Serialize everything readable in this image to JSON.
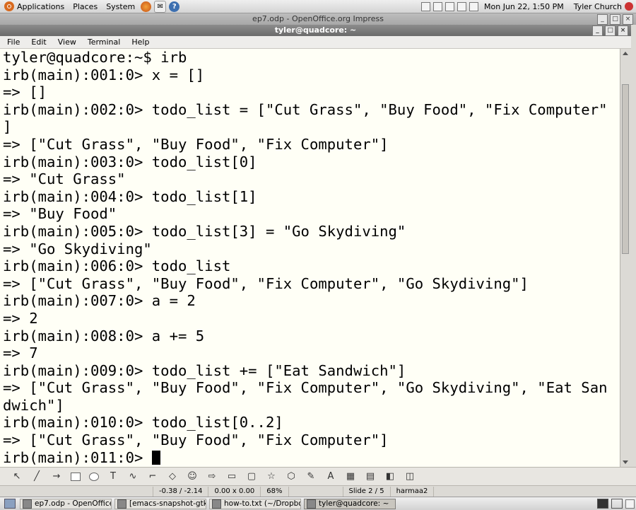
{
  "top_panel": {
    "menus": [
      "Applications",
      "Places",
      "System"
    ],
    "clock": "Mon Jun 22,  1:50 PM",
    "user": "Tyler Church"
  },
  "impress_window": {
    "title": "ep7.odp - OpenOffice.org Impress"
  },
  "terminal_window": {
    "title": "tyler@quadcore: ~",
    "menus": [
      "File",
      "Edit",
      "View",
      "Terminal",
      "Help"
    ],
    "lines": [
      "tyler@quadcore:~$ irb",
      "irb(main):001:0> x = []",
      "=> []",
      "irb(main):002:0> todo_list = [\"Cut Grass\", \"Buy Food\", \"Fix Computer\"",
      "]",
      "=> [\"Cut Grass\", \"Buy Food\", \"Fix Computer\"]",
      "irb(main):003:0> todo_list[0]",
      "=> \"Cut Grass\"",
      "irb(main):004:0> todo_list[1]",
      "=> \"Buy Food\"",
      "irb(main):005:0> todo_list[3] = \"Go Skydiving\"",
      "=> \"Go Skydiving\"",
      "irb(main):006:0> todo_list",
      "=> [\"Cut Grass\", \"Buy Food\", \"Fix Computer\", \"Go Skydiving\"]",
      "irb(main):007:0> a = 2",
      "=> 2",
      "irb(main):008:0> a += 5",
      "=> 7",
      "irb(main):009:0> todo_list += [\"Eat Sandwich\"]",
      "=> [\"Cut Grass\", \"Buy Food\", \"Fix Computer\", \"Go Skydiving\", \"Eat San",
      "dwich\"]",
      "irb(main):010:0> todo_list[0..2]",
      "=> [\"Cut Grass\", \"Buy Food\", \"Fix Computer\"]",
      "irb(main):011:0> "
    ]
  },
  "status_bar": {
    "position": "-0.38 / -2.14",
    "size": "0.00 x 0.00",
    "zoom": "68%",
    "slide": "Slide 2 / 5",
    "layout": "harmaa2"
  },
  "taskbar": {
    "tasks": [
      "ep7.odp - OpenOffice....",
      "[emacs-snapshot-gtk...",
      "how-to.txt (~/Dropbox...",
      "tyler@quadcore: ~"
    ],
    "active_task_index": 3
  }
}
